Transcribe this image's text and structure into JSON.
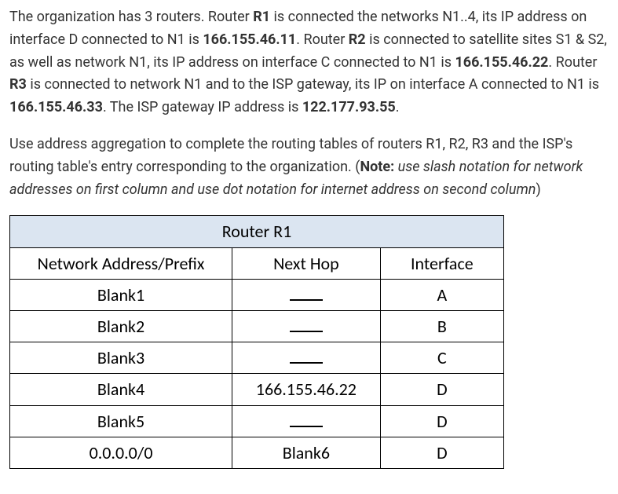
{
  "para1": {
    "t0": "The organization has 3 routers. Router ",
    "r1": "R1",
    "t1": " is connected the networks N1..4, its IP address on interface D connected to N1 is ",
    "ip1": "166.155.46.11",
    "t2": ". Router ",
    "r2": "R2",
    "t3": " is connected to satellite sites S1 & S2, as well as network N1, its IP address on interface C connected to N1 is ",
    "ip2": "166.155.46.22",
    "t4": ". Router ",
    "r3": "R3",
    "t5": " is connected to network N1 and to the ISP gateway, its IP on interface A connected to N1 is ",
    "ip3": "166.155.46.33",
    "t6": ". The ISP gateway IP address is ",
    "ip4": "122.177.93.55",
    "t7": "."
  },
  "para2": {
    "t0": "Use address aggregation to complete the routing tables of routers R1, R2, R3 and the ISP's routing table's entry corresponding to the organization. (",
    "noteLabel": "Note:",
    "noteText": " use slash notation for network addresses on first column and use dot notation for internet address on second column",
    "t1": ")"
  },
  "table": {
    "title": "Router R1",
    "headers": {
      "net": "Network Address/Prefix",
      "hop": "Next Hop",
      "iface": "Interface"
    },
    "rows": [
      {
        "net": "Blank1",
        "hop": "",
        "iface": "A"
      },
      {
        "net": "Blank2",
        "hop": "",
        "iface": "B"
      },
      {
        "net": "Blank3",
        "hop": "",
        "iface": "C"
      },
      {
        "net": "Blank4",
        "hop": "166.155.46.22",
        "iface": "D"
      },
      {
        "net": "Blank5",
        "hop": "",
        "iface": "D"
      },
      {
        "net": "0.0.0.0/0",
        "hop": "Blank6",
        "iface": "D"
      }
    ]
  }
}
